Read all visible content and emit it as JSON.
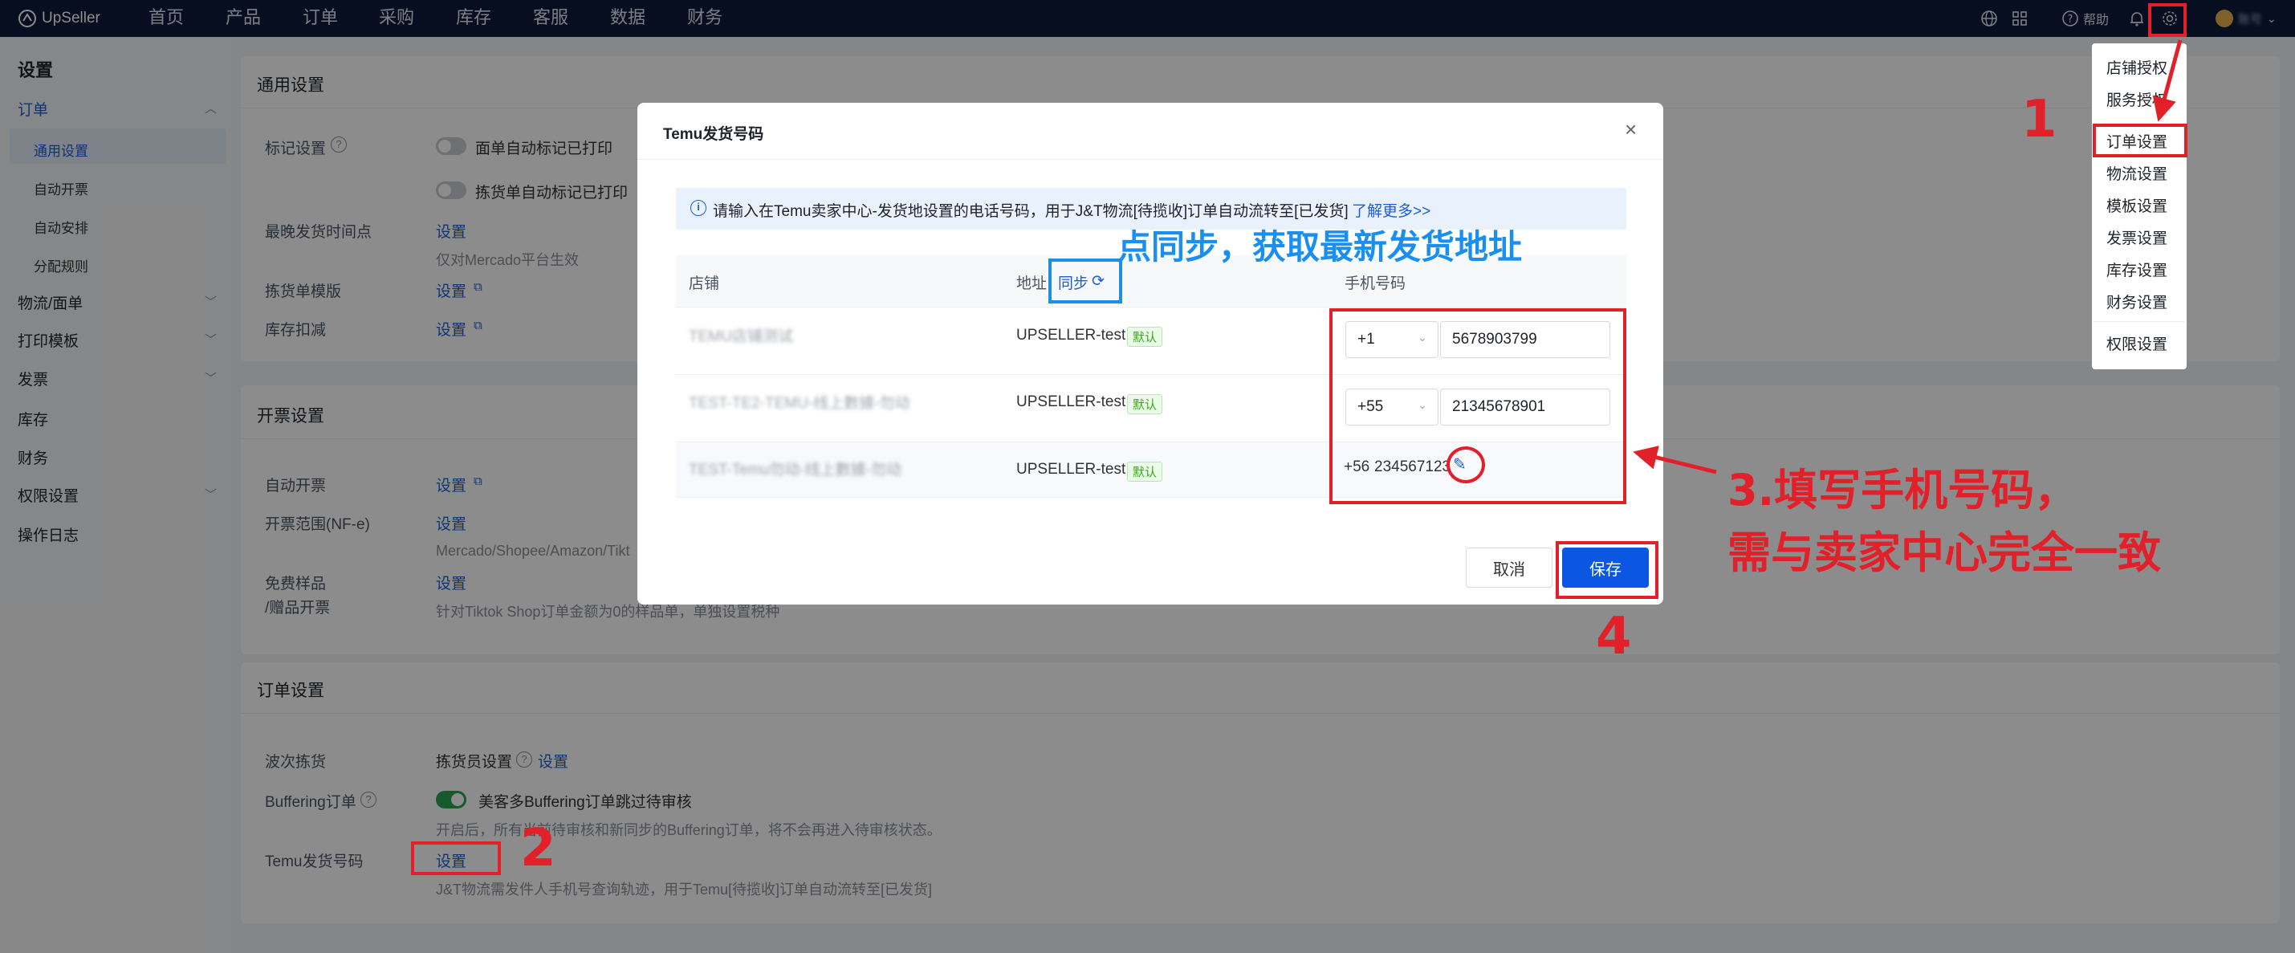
{
  "app": {
    "logo": "UpSeller"
  },
  "topnav": {
    "items": [
      "首页",
      "产品",
      "订单",
      "采购",
      "库存",
      "客服",
      "数据",
      "财务"
    ],
    "help": "帮助",
    "user": "账号"
  },
  "sidebar": {
    "title": "设置",
    "items": [
      "订单",
      "通用设置",
      "自动开票",
      "自动安排",
      "分配规则",
      "物流/面单",
      "打印模板",
      "发票",
      "库存",
      "财务",
      "权限设置",
      "操作日志"
    ]
  },
  "general": {
    "title": "通用设置",
    "mark_label": "标记设置",
    "toggle1": "面单自动标记已打印",
    "toggle2": "拣货单自动标记已打印",
    "latest_label": "最晚发货时间点",
    "latest_link": "设置",
    "latest_note": "仅对Mercado平台生效",
    "picklist_label": "拣货单模版",
    "picklist_link": "设置",
    "stock_label": "库存扣减",
    "stock_link": "设置"
  },
  "invoice": {
    "title": "开票设置",
    "auto_label": "自动开票",
    "auto_link": "设置",
    "range_label": "开票范围(NF-e)",
    "range_link": "设置",
    "range_note": "Mercado/Shopee/Amazon/Tikt",
    "free_label1": "免费样品",
    "free_label2": "/赠品开票",
    "free_link": "设置",
    "free_note": "针对Tiktok Shop订单金额为0的样品单，单独设置税种"
  },
  "order": {
    "title": "订单设置",
    "wave_label": "波次拣货",
    "wave_value": "拣货员设置",
    "wave_link": "设置",
    "buffer_label": "Buffering订单",
    "buffer_toggle": "美客多Buffering订单跳过待审核",
    "buffer_note": "开启后，所有当前待审核和新同步的Buffering订单，将不会再进入待审核状态。",
    "temu_label": "Temu发货号码",
    "temu_link": "设置",
    "temu_note": "J&T物流需发件人手机号查询轨迹，用于Temu[待揽收]订单自动流转至[已发货]"
  },
  "modal": {
    "title": "Temu发货号码",
    "info": "请输入在Temu卖家中心-发货地设置的电话号码，用于J&T物流[待揽收]订单自动流转至[已发货]",
    "learn_more": "了解更多>>",
    "col_store": "店铺",
    "col_address": "地址",
    "sync": "同步",
    "col_phone": "手机号码",
    "rows": [
      {
        "store": "TEMU店铺测试",
        "address": "UPSELLER-test",
        "tag": "默认",
        "code": "+1",
        "phone": "5678903799"
      },
      {
        "store": "TEST-TE2-TEMU-线上數據-勿动",
        "address": "UPSELLER-test",
        "tag": "默认",
        "code": "+55",
        "phone": "21345678901"
      },
      {
        "store": "TEST-Temu勿动-线上數據-勿动",
        "address": "UPSELLER-test",
        "tag": "默认",
        "code": "+56",
        "phone": "234567123"
      }
    ],
    "cancel": "取消",
    "save": "保存"
  },
  "dropdown": {
    "items": [
      "店铺授权",
      "服务授权",
      "订单设置",
      "物流设置",
      "模板设置",
      "发票设置",
      "库存设置",
      "财务设置",
      "权限设置"
    ]
  },
  "annotations": {
    "n1": "1",
    "n2": "2",
    "n4": "4",
    "sync_note": "点同步，获取最新发货地址",
    "step3_line1": "3.填写手机号码，",
    "step3_line2": "需与卖家中心完全一致"
  },
  "colors": {
    "nav_bg": "#0c1a3a",
    "primary": "#1d5dd6",
    "annotation_red": "#e1202a",
    "annotation_blue": "#1a8ff0",
    "toggle_on": "#2aa44f"
  }
}
